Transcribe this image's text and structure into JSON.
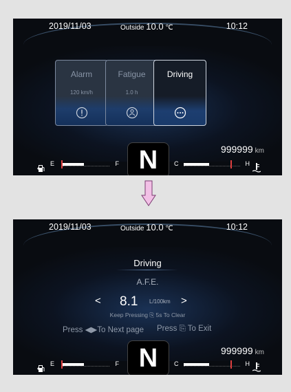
{
  "top_screen": {
    "date": "2019/11/03",
    "outside_label": "Outside",
    "outside_temp": "10.0",
    "temp_unit": "℃",
    "time": "10:12",
    "cards": [
      {
        "title": "Alarm",
        "value": "120 km/h",
        "icon": "exclamation-icon"
      },
      {
        "title": "Fatigue",
        "value": "1.0 h",
        "icon": "driver-icon"
      },
      {
        "title": "Driving",
        "value": "",
        "icon": "more-dots-icon"
      }
    ],
    "gear": "N",
    "odometer": "999999",
    "odometer_unit": "km",
    "fuel_gauge": {
      "empty_label": "E",
      "full_label": "F",
      "level": 0.45
    },
    "coolant_gauge": {
      "cold_label": "C",
      "hot_label": "H",
      "level": 0.45
    }
  },
  "bottom_screen": {
    "date": "2019/11/03",
    "outside_label": "Outside",
    "outside_temp": "10.0",
    "temp_unit": "℃",
    "time": "10:12",
    "title": "Driving",
    "subtitle": "A.F.E.",
    "value": "8.1",
    "value_unit": "L/100km",
    "hint": "Keep Pressing ⎘ 5s To Clear",
    "nav_hint": "Press ◀▶To Next page",
    "exit_hint": "Press ⎘ To Exit",
    "gear": "N",
    "odometer": "999999",
    "odometer_unit": "km",
    "fuel_gauge": {
      "empty_label": "E",
      "full_label": "F",
      "level": 0.45
    },
    "coolant_gauge": {
      "cold_label": "C",
      "hot_label": "H",
      "level": 0.45
    }
  },
  "colors": {
    "accent_blue": "#1e3d6b",
    "gauge_red": "#e04040",
    "background": "#090c11"
  }
}
